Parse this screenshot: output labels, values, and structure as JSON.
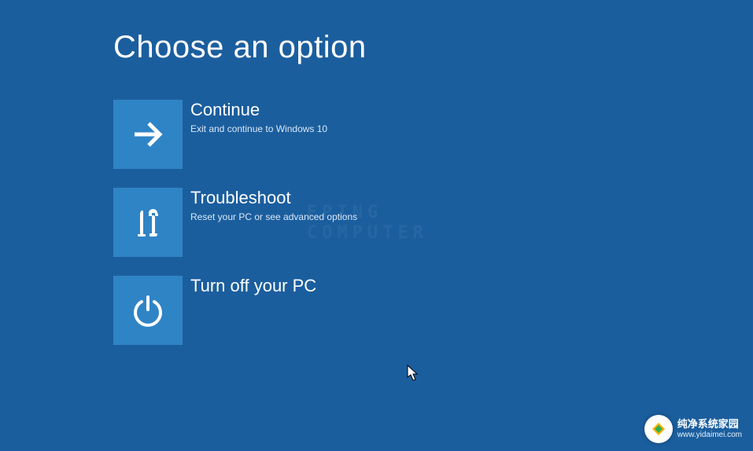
{
  "page_title": "Choose an option",
  "options": [
    {
      "title": "Continue",
      "subtitle": "Exit and continue to Windows 10",
      "icon": "arrow-right"
    },
    {
      "title": "Troubleshoot",
      "subtitle": "Reset your PC or see advanced options",
      "icon": "tools"
    },
    {
      "title": "Turn off your PC",
      "subtitle": "",
      "icon": "power"
    }
  ],
  "watermark": {
    "line1": "纯净系统家园",
    "line2": "www.yidaimei.com"
  },
  "ghost": {
    "line1": "EPING",
    "line2": "COMPUTER"
  }
}
